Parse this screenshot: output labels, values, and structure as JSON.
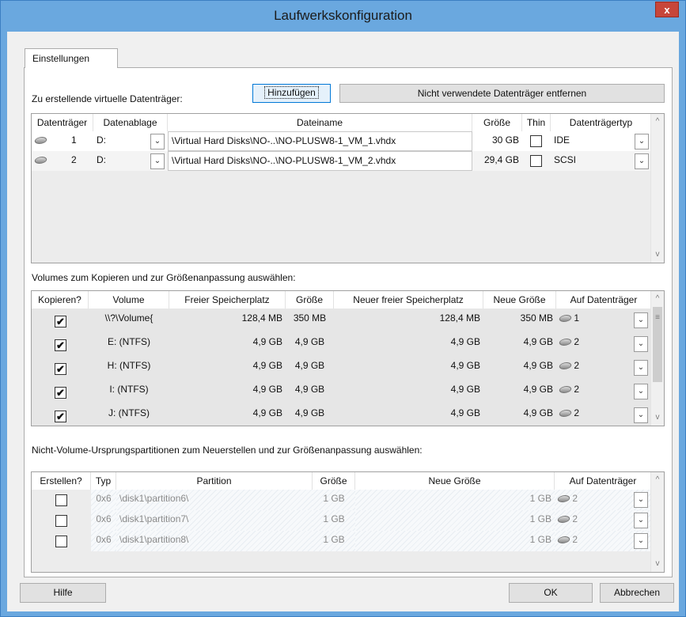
{
  "window": {
    "title": "Laufwerkskonfiguration",
    "close": "x"
  },
  "tab": {
    "label": "Einstellungen"
  },
  "disks_section": {
    "label": "Zu erstellende virtuelle Datenträger:",
    "add_button": "Hinzufügen",
    "remove_button": "Nicht verwendete Datenträger entfernen",
    "headers": [
      "Datenträger",
      "Datenablage",
      "Dateiname",
      "Größe",
      "Thin",
      "Datenträgertyp"
    ],
    "rows": [
      {
        "num": "1",
        "store": "D:",
        "file": "\\Virtual Hard Disks\\NO-..\\NO-PLUSW8-1_VM_1.vhdx",
        "size": "30 GB",
        "thin": false,
        "type": "IDE"
      },
      {
        "num": "2",
        "store": "D:",
        "file": "\\Virtual Hard Disks\\NO-..\\NO-PLUSW8-1_VM_2.vhdx",
        "size": "29,4 GB",
        "thin": false,
        "type": "SCSI"
      }
    ]
  },
  "volumes_section": {
    "label": "Volumes zum Kopieren und zur Größenanpassung auswählen:",
    "headers": [
      "Kopieren?",
      "Volume",
      "Freier Speicherplatz",
      "Größe",
      "Neuer freier Speicherplatz",
      "Neue Größe",
      "Auf Datenträger"
    ],
    "rows": [
      {
        "copy": true,
        "volume": "\\\\?\\Volume{",
        "free": "128,4 MB",
        "size": "350 MB",
        "new_free": "128,4 MB",
        "new_size": "350 MB",
        "disk": "1"
      },
      {
        "copy": true,
        "volume": "E: (NTFS)",
        "free": "4,9 GB",
        "size": "4,9 GB",
        "new_free": "4,9 GB",
        "new_size": "4,9 GB",
        "disk": "2"
      },
      {
        "copy": true,
        "volume": "H: (NTFS)",
        "free": "4,9 GB",
        "size": "4,9 GB",
        "new_free": "4,9 GB",
        "new_size": "4,9 GB",
        "disk": "2"
      },
      {
        "copy": true,
        "volume": "I: (NTFS)",
        "free": "4,9 GB",
        "size": "4,9 GB",
        "new_free": "4,9 GB",
        "new_size": "4,9 GB",
        "disk": "2"
      },
      {
        "copy": true,
        "volume": "J: (NTFS)",
        "free": "4,9 GB",
        "size": "4,9 GB",
        "new_free": "4,9 GB",
        "new_size": "4,9 GB",
        "disk": "2"
      }
    ]
  },
  "partitions_section": {
    "label": "Nicht-Volume-Ursprungspartitionen zum Neuerstellen und zur Größenanpassung auswählen:",
    "headers": [
      "Erstellen?",
      "Typ",
      "Partition",
      "Größe",
      "Neue Größe",
      "Auf Datenträger"
    ],
    "rows": [
      {
        "create": false,
        "type": "0x6",
        "partition": "\\disk1\\partition6\\",
        "size": "1 GB",
        "new_size": "1 GB",
        "disk": "2"
      },
      {
        "create": false,
        "type": "0x6",
        "partition": "\\disk1\\partition7\\",
        "size": "1 GB",
        "new_size": "1 GB",
        "disk": "2"
      },
      {
        "create": false,
        "type": "0x6",
        "partition": "\\disk1\\partition8\\",
        "size": "1 GB",
        "new_size": "1 GB",
        "disk": "2"
      }
    ]
  },
  "footer": {
    "help": "Hilfe",
    "ok": "OK",
    "cancel": "Abbrechen"
  },
  "glyphs": {
    "check": "✔",
    "dropdown": "⌄",
    "scroll_up": "^",
    "scroll_down": "v",
    "grip": "≡"
  },
  "colors": {
    "title_bar": "#6aa8df",
    "close": "#c7463a",
    "focus": "#0078d7"
  }
}
